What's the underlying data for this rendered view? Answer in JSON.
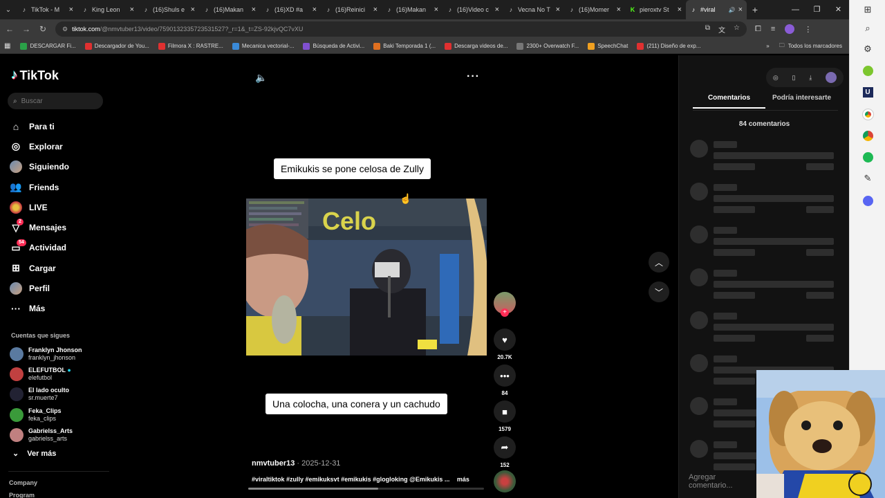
{
  "browser": {
    "tabs": [
      {
        "label": "TikTok - M",
        "icon": "tiktok"
      },
      {
        "label": "King Leon",
        "icon": "tiktok"
      },
      {
        "label": "(16)Shuls e",
        "icon": "tiktok"
      },
      {
        "label": "(16)Makan",
        "icon": "tiktok"
      },
      {
        "label": "(16)XD #a",
        "icon": "tiktok"
      },
      {
        "label": "(16)Reinici",
        "icon": "tiktok"
      },
      {
        "label": "(16)Makan",
        "icon": "tiktok"
      },
      {
        "label": "(16)Video c",
        "icon": "tiktok"
      },
      {
        "label": "Vecna No T",
        "icon": "tiktok"
      },
      {
        "label": "(16)Momer",
        "icon": "tiktok"
      },
      {
        "label": "pieroxtv St",
        "icon": "kick"
      },
      {
        "label": "#viral",
        "icon": "tiktok",
        "active": true
      }
    ],
    "url_host": "tiktok.com",
    "url_path": "/@nmvtuber13/video/7590132335723531527?_r=1&_t=ZS-92kjvQC7vXU",
    "bookmarks": [
      {
        "label": "DESCARGAR Fi...",
        "color": "#2aa148"
      },
      {
        "label": "Descargador de You...",
        "color": "#e03030"
      },
      {
        "label": "Filmora X : RASTRE...",
        "color": "#e03030"
      },
      {
        "label": "Mecanica vectorial-...",
        "color": "#3a8ad8"
      },
      {
        "label": "Búsqueda de Activi...",
        "color": "#8050d0"
      },
      {
        "label": "Baki Temporada 1 (...",
        "color": "#e07020"
      },
      {
        "label": "Descarga videos de...",
        "color": "#e03030"
      },
      {
        "label": "2300+ Overwatch F...",
        "color": "#777777"
      },
      {
        "label": "SpeechChat",
        "color": "#f0a020"
      },
      {
        "label": "(211) Diseño de exp...",
        "color": "#e03030"
      }
    ],
    "bookmarks_all": "Todos los marcadores"
  },
  "tiktok": {
    "logo": "TikTok",
    "search_placeholder": "Buscar",
    "nav": [
      {
        "label": "Para ti",
        "icon": "home-icon"
      },
      {
        "label": "Explorar",
        "icon": "compass-icon"
      },
      {
        "label": "Siguiendo",
        "icon": "avatar"
      },
      {
        "label": "Friends",
        "icon": "friends-icon"
      },
      {
        "label": "LIVE",
        "icon": "live-avatar"
      },
      {
        "label": "Mensajes",
        "icon": "message-icon",
        "badge": "2"
      },
      {
        "label": "Actividad",
        "icon": "activity-icon",
        "badge": "54"
      },
      {
        "label": "Cargar",
        "icon": "upload-icon"
      },
      {
        "label": "Perfil",
        "icon": "avatar"
      },
      {
        "label": "Más",
        "icon": "more-icon"
      }
    ],
    "following_title": "Cuentas que sigues",
    "following": [
      {
        "name": "Franklyn Jhonson",
        "handle": "franklyn_jhonson",
        "color": "#5a7aa0"
      },
      {
        "name": "ELEFUTBOL",
        "handle": "elefutbol",
        "verified": true,
        "color": "#c04040"
      },
      {
        "name": "El lado oculto",
        "handle": "sr.muerte7",
        "color": "#222233"
      },
      {
        "name": "Feka_Clips",
        "handle": "feka_clips",
        "color": "#3a9a3a"
      },
      {
        "name": "Gabrielss_Arts",
        "handle": "gabrielss_arts",
        "color": "#c08080"
      }
    ],
    "ver_mas": "Ver más",
    "footer": [
      "Company",
      "Program"
    ]
  },
  "video": {
    "caption_top": "Emikukis se pone celosa de Zully",
    "overlay_text": "Celo",
    "caption_bottom": "Una colocha, una conera y un cachudo",
    "author": "nmvtuber13",
    "date": "2025-12-31",
    "hashtags": "#viraltiktok  #zully #emikuksvt #emikukis #glogloking @Emikukis ...",
    "more_label": "más",
    "progress": 0.55,
    "likes": "20.7K",
    "comments": "84",
    "saves": "1579",
    "shares": "152"
  },
  "comments_panel": {
    "tab_comments": "Comentarios",
    "tab_interesting": "Podría interesarte",
    "count": "84 comentarios",
    "input_placeholder": "Agregar comentario..."
  }
}
